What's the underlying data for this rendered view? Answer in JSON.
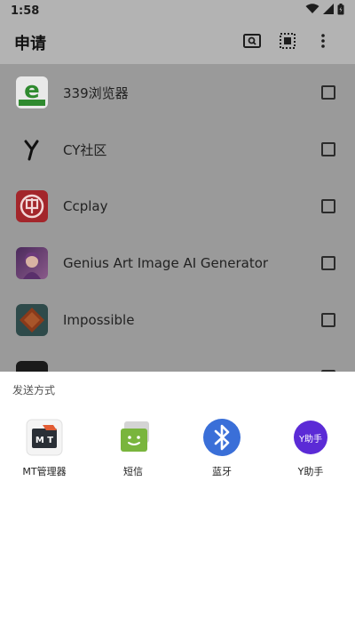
{
  "status_bar": {
    "time": "1:58"
  },
  "app_bar": {
    "title": "申请"
  },
  "apps": [
    {
      "name": "339浏览器",
      "checked": false,
      "icon": "e-browser-icon"
    },
    {
      "name": "CY社区",
      "checked": false,
      "icon": "cy-icon"
    },
    {
      "name": "Ccplay",
      "checked": false,
      "icon": "ccplay-icon"
    },
    {
      "name": "Genius Art Image AI Generator",
      "checked": false,
      "icon": "genius-art-icon"
    },
    {
      "name": "Impossible",
      "checked": false,
      "icon": "impossible-icon"
    }
  ],
  "share_sheet": {
    "title": "发送方式",
    "targets": [
      {
        "label": "MT管理器",
        "icon": "mt-manager-icon"
      },
      {
        "label": "短信",
        "icon": "sms-icon"
      },
      {
        "label": "蓝牙",
        "icon": "bluetooth-icon"
      },
      {
        "label": "Y助手",
        "icon": "y-helper-icon",
        "icon_text": "Y助手"
      }
    ]
  },
  "colors": {
    "dim_bar": "#b3b3b3",
    "dim_list": "#9a9a9a",
    "bluetooth": "#3a6fd8",
    "sms": "#79b53d",
    "y_helper": "#5b2bd6"
  }
}
